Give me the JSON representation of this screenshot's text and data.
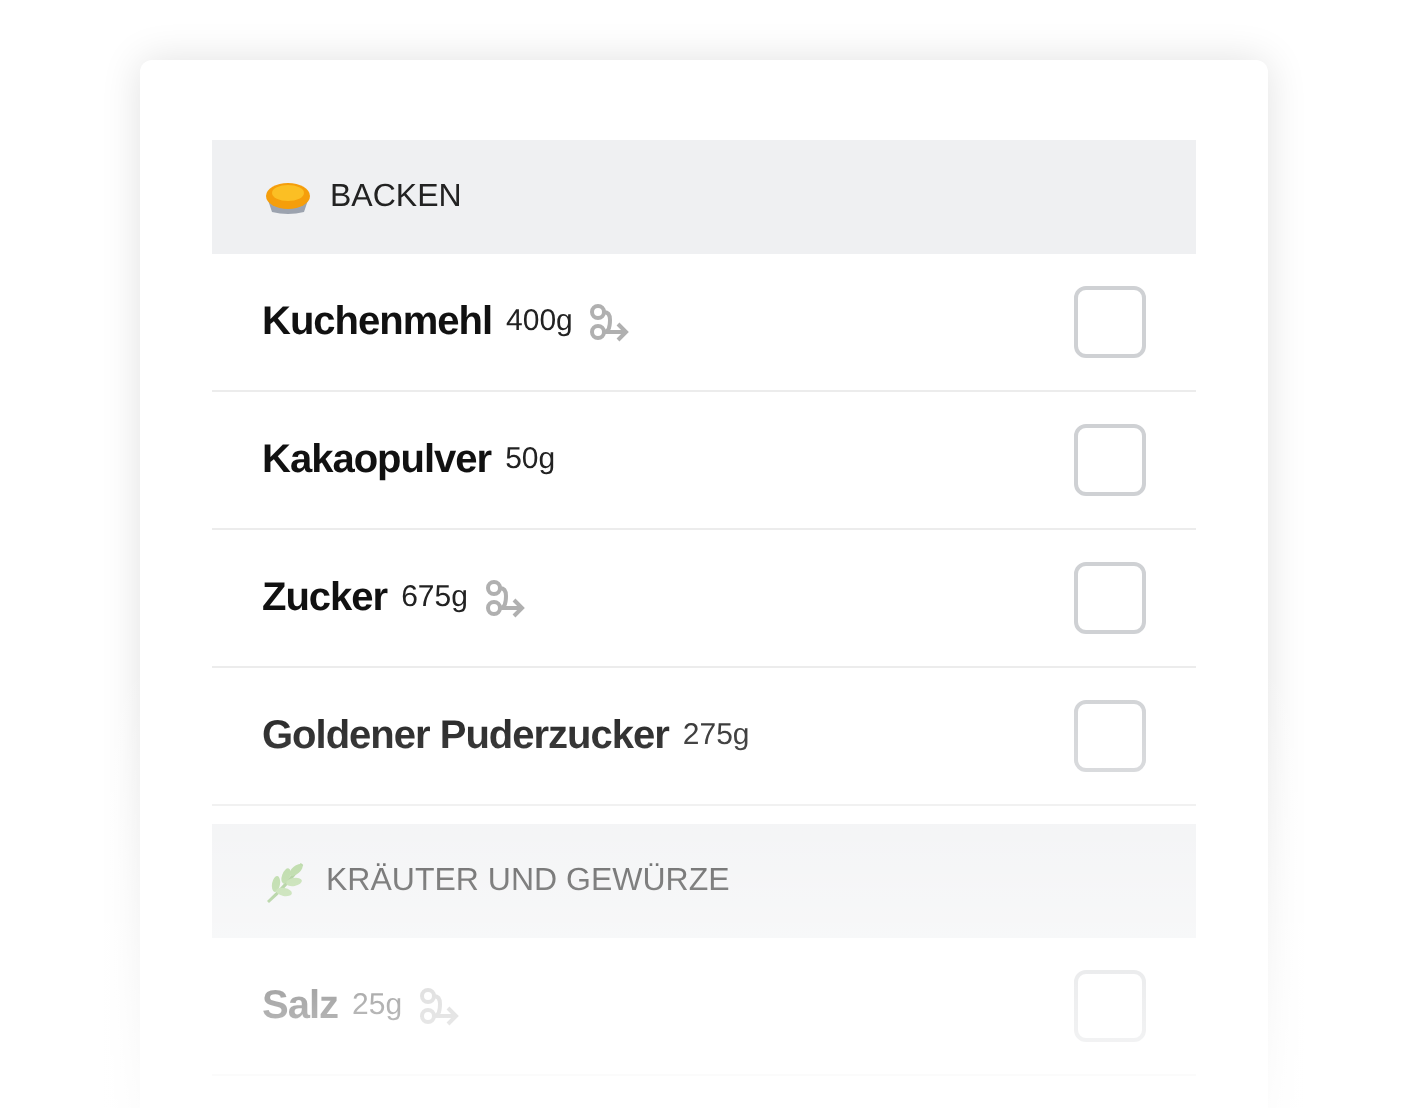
{
  "sections": [
    {
      "title": "BACKEN",
      "kind": "pie",
      "items": [
        {
          "name": "Kuchenmehl",
          "amount": "400g",
          "route_icon": true,
          "checked": false
        },
        {
          "name": "Kakaopulver",
          "amount": "50g",
          "route_icon": false,
          "checked": false
        },
        {
          "name": "Zucker",
          "amount": "675g",
          "route_icon": true,
          "checked": false
        },
        {
          "name": "Goldener Puderzucker",
          "amount": "275g",
          "route_icon": false,
          "checked": false
        }
      ]
    },
    {
      "title": "KRÄUTER UND GEWÜRZE",
      "kind": "herb",
      "items": [
        {
          "name": "Salz",
          "amount": "25g",
          "route_icon": true,
          "checked": false
        }
      ]
    }
  ]
}
